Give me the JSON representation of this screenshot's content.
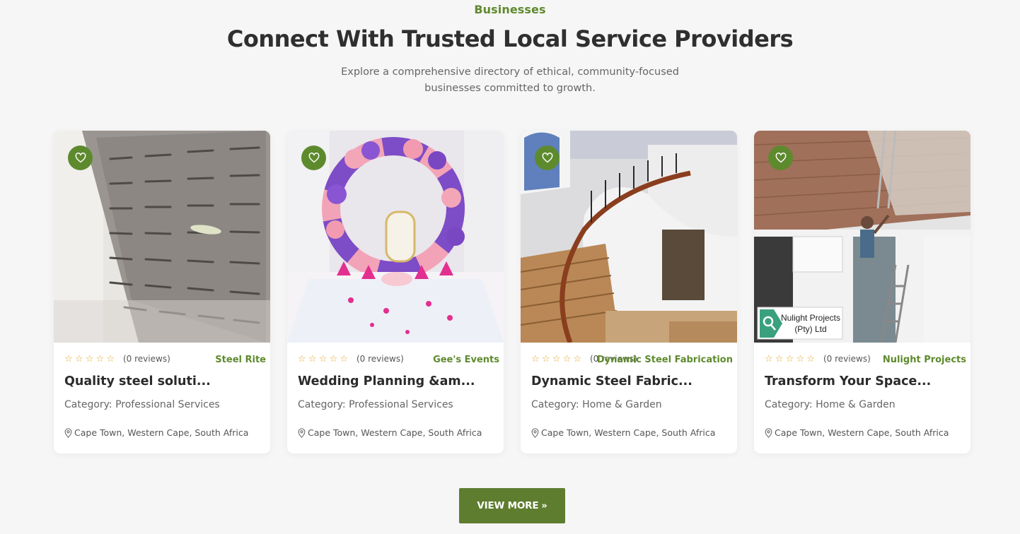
{
  "section": {
    "eyebrow": "Businesses",
    "title": "Connect With Trusted Local Service Providers",
    "subtitle": "Explore a comprehensive directory of ethical, community-focused businesses committed to growth."
  },
  "cards": [
    {
      "stars": "☆☆☆☆☆",
      "rating": 0,
      "reviews": "(0 reviews)",
      "business": "Steel Rite",
      "title": "Quality steel soluti...",
      "category": "Category: Professional Services",
      "location": "Cape Town, Western Cape, South Africa",
      "image_icon": "wine-rack-image"
    },
    {
      "stars": "☆☆☆☆☆",
      "rating": 0,
      "reviews": "(0 reviews)",
      "business": "Gee's Events",
      "title": "Wedding Planning &am...",
      "category": "Category: Professional Services",
      "location": "Cape Town, Western Cape, South Africa",
      "image_icon": "balloon-arch-image"
    },
    {
      "stars": "☆☆☆☆☆",
      "rating": 0,
      "reviews": "(0 reviews)",
      "business": "Dynamic Steel Fabrication",
      "title": "Dynamic Steel Fabric...",
      "category": "Category: Home & Garden",
      "location": "Cape Town, Western Cape, South Africa",
      "image_icon": "staircase-image"
    },
    {
      "stars": "☆☆☆☆☆",
      "rating": 0,
      "reviews": "(0 reviews)",
      "business": "Nulight Projects",
      "title": "Transform Your Space...",
      "category": "Category: Home & Garden",
      "location": "Cape Town, Western Cape, South Africa",
      "image_icon": "ceiling-painting-image",
      "image_logo_text": [
        "Nulight Projects",
        "(Pty) Ltd"
      ]
    }
  ],
  "view_more": {
    "label": "VIEW MORE",
    "icon": "double-chevron-right-icon"
  },
  "colors": {
    "accent": "#5e8a2e",
    "button": "#5e7d2f",
    "star": "#e3a82a",
    "background": "#f6f6f6"
  }
}
